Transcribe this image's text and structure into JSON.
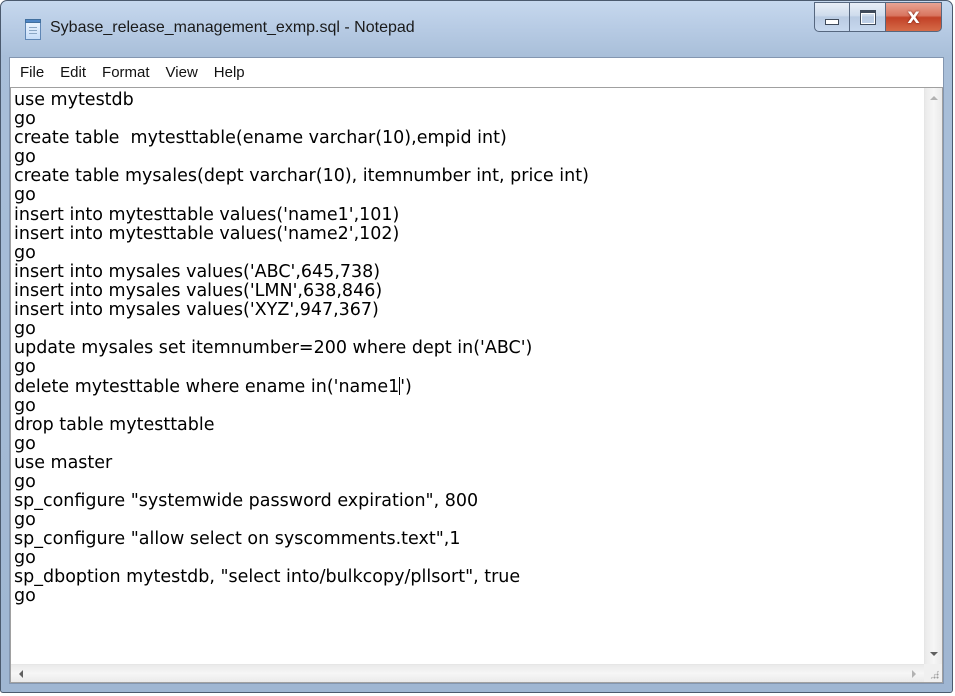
{
  "window": {
    "title": "Sybase_release_management_exmp.sql - Notepad",
    "close_glyph": "X"
  },
  "menu": [
    "File",
    "Edit",
    "Format",
    "View",
    "Help"
  ],
  "editor": {
    "lines": [
      "use mytestdb",
      "go",
      "create table  mytesttable(ename varchar(10),empid int)",
      "go",
      "create table mysales(dept varchar(10), itemnumber int, price int)",
      "go",
      "insert into mytesttable values('name1',101)",
      "insert into mytesttable values('name2',102)",
      "go",
      "insert into mysales values('ABC',645,738)",
      "insert into mysales values('LMN',638,846)",
      "insert into mysales values('XYZ',947,367)",
      "go",
      "update mysales set itemnumber=200 where dept in('ABC')",
      "go",
      "delete mytesttable where ename in('name1')",
      "go",
      "drop table mytesttable",
      "go",
      "use master",
      "go",
      "sp_configure \"systemwide password expiration\", 800",
      "go",
      "sp_configure \"allow select on syscomments.text\",1",
      "go",
      "sp_dboption mytestdb, \"select into/bulkcopy/pllsort\", true",
      "go"
    ],
    "caret_line": 15,
    "caret_col": 40
  },
  "icons": {
    "app": "notepad-icon",
    "minimize": "minimize-icon",
    "maximize": "maximize-icon",
    "close": "close-icon"
  }
}
